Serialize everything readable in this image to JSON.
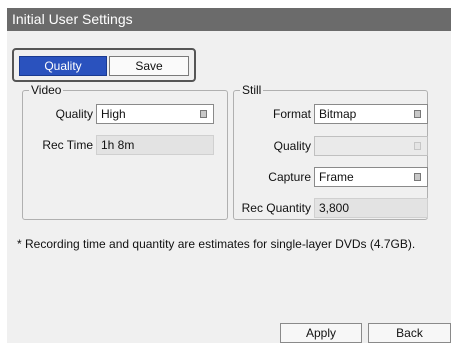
{
  "window": {
    "title": "Initial User Settings"
  },
  "tabs": [
    {
      "label": "Quality",
      "active": true
    },
    {
      "label": "Save",
      "active": false
    }
  ],
  "video": {
    "title": "Video",
    "quality_label": "Quality",
    "quality_value": "High",
    "rec_time_label": "Rec Time",
    "rec_time_value": "1h 8m"
  },
  "still": {
    "title": "Still",
    "format_label": "Format",
    "format_value": "Bitmap",
    "quality_label": "Quality",
    "quality_value": "",
    "capture_label": "Capture",
    "capture_value": "Frame",
    "rec_quantity_label": "Rec Quantity",
    "rec_quantity_value": "3,800"
  },
  "note": "* Recording time and quantity are estimates for single-layer DVDs (4.7GB).",
  "buttons": {
    "apply": "Apply",
    "back": "Back"
  },
  "colors": {
    "titlebar": "#6b6b6b",
    "accent": "#2a52be",
    "panel": "#f0f0f0"
  }
}
